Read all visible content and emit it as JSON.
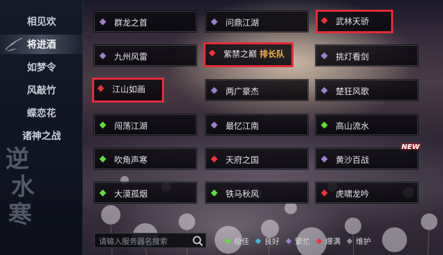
{
  "sidebar": {
    "items": [
      {
        "label": "相见欢",
        "active": false
      },
      {
        "label": "将进酒",
        "active": true
      },
      {
        "label": "如梦令",
        "active": false
      },
      {
        "label": "风敲竹",
        "active": false
      },
      {
        "label": "蝶恋花",
        "active": false
      },
      {
        "label": "诸神之战",
        "active": false
      }
    ],
    "calligraphy": [
      "逆",
      "水",
      "寒"
    ]
  },
  "servers": [
    {
      "name": "群龙之首",
      "status": "busy",
      "highlighted": false
    },
    {
      "name": "问鼎江湖",
      "status": "busy",
      "highlighted": false
    },
    {
      "name": "武林天骄",
      "status": "full",
      "highlighted": true
    },
    {
      "name": "九州风雷",
      "status": "busy",
      "highlighted": false
    },
    {
      "name": "紫禁之巅",
      "status": "full",
      "highlighted": true,
      "tag": "排长队"
    },
    {
      "name": "挑灯看剑",
      "status": "busy",
      "highlighted": false
    },
    {
      "name": "江山如画",
      "status": "full",
      "highlighted": true
    },
    {
      "name": "两广豪杰",
      "status": "busy",
      "highlighted": false
    },
    {
      "name": "楚狂风歌",
      "status": "busy",
      "highlighted": false
    },
    {
      "name": "闯荡江湖",
      "status": "ok",
      "highlighted": false
    },
    {
      "name": "最忆江南",
      "status": "busy",
      "highlighted": false
    },
    {
      "name": "高山流水",
      "status": "ok",
      "highlighted": false
    },
    {
      "name": "吹角声寒",
      "status": "ok",
      "highlighted": false
    },
    {
      "name": "天府之国",
      "status": "full",
      "highlighted": false
    },
    {
      "name": "黄沙百战",
      "status": "busy",
      "highlighted": false,
      "badge": "NEW"
    },
    {
      "name": "大漠孤烟",
      "status": "ok",
      "highlighted": false
    },
    {
      "name": "铁马秋风",
      "status": "ok",
      "highlighted": false
    },
    {
      "name": "虎啸龙吟",
      "status": "full",
      "highlighted": false
    }
  ],
  "search": {
    "placeholder": "请输入服务器名搜索",
    "value": ""
  },
  "legend": [
    {
      "label": "极佳",
      "status": "ok"
    },
    {
      "label": "良好",
      "status": "good"
    },
    {
      "label": "繁忙",
      "status": "busy"
    },
    {
      "label": "爆满",
      "status": "full"
    },
    {
      "label": "维护",
      "status": "maint"
    }
  ],
  "colors": {
    "ok": "#5fe03a",
    "good": "#45b8d8",
    "busy": "#9b7fd0",
    "full": "#f0323c",
    "maint": "#8e8e96",
    "highlight_border": "#e62b38",
    "tag": "#f1b04a"
  }
}
